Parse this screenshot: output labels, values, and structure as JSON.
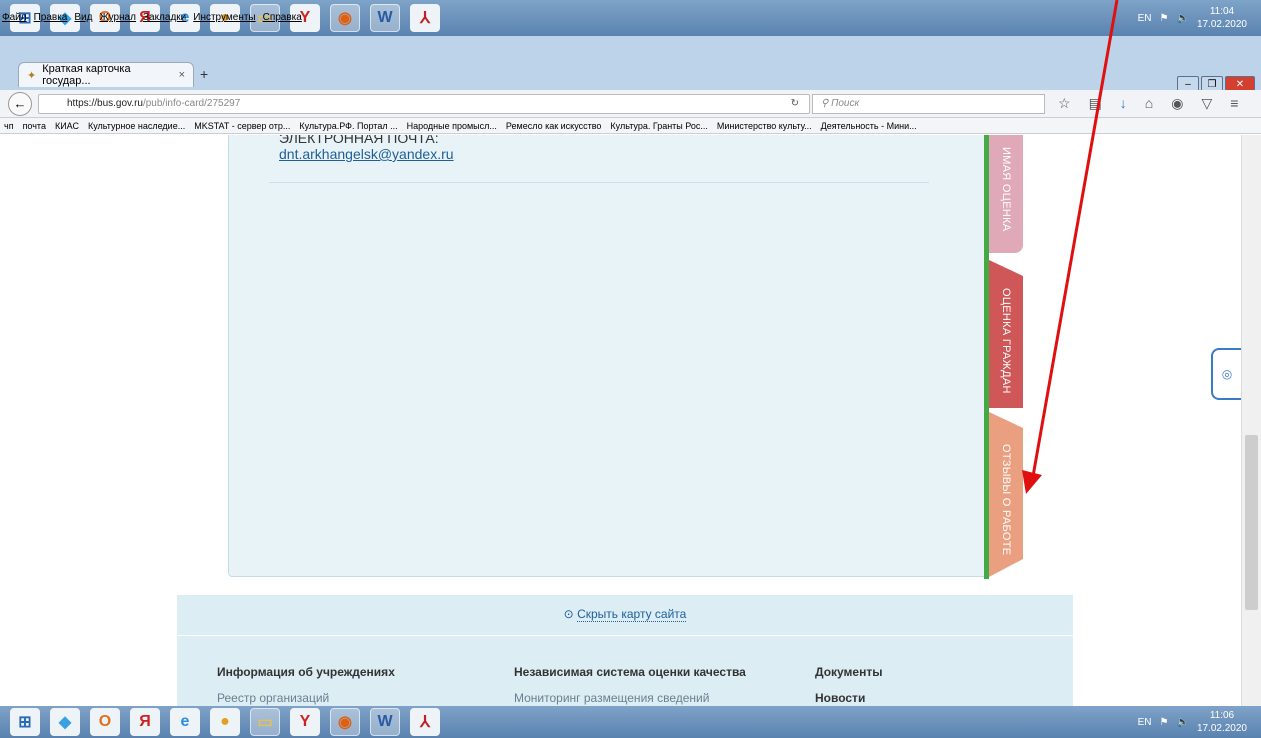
{
  "taskbar": {
    "apps": [
      {
        "name": "windows-start-icon",
        "glyph": "⊞",
        "color": "#2a6bb5"
      },
      {
        "name": "app-2-icon",
        "glyph": "◆",
        "color": "#3aa0e0"
      },
      {
        "name": "outlook-icon",
        "glyph": "O",
        "color": "#e07020"
      },
      {
        "name": "yandex-icon",
        "glyph": "Я",
        "color": "#d02020"
      },
      {
        "name": "ie-icon",
        "glyph": "e",
        "color": "#2a8fe0"
      },
      {
        "name": "chrome-icon",
        "glyph": "●",
        "color": "#e0a020"
      },
      {
        "name": "folder-icon",
        "glyph": "▭",
        "color": "#e8c050"
      },
      {
        "name": "yandex-browser-icon",
        "glyph": "Y",
        "color": "#d02020"
      },
      {
        "name": "firefox-icon",
        "glyph": "◉",
        "color": "#e06010"
      },
      {
        "name": "word-icon",
        "glyph": "W",
        "color": "#2a5aa0"
      },
      {
        "name": "acrobat-icon",
        "glyph": "⅄",
        "color": "#c02020"
      }
    ],
    "top_time": "11:04",
    "top_date": "17.02.2020",
    "bottom_time": "11:06",
    "bottom_date": "17.02.2020",
    "lang": "EN"
  },
  "menu": [
    "Файл",
    "Правка",
    "Вид",
    "Журнал",
    "Закладки",
    "Инструменты",
    "Справка"
  ],
  "tab": {
    "title": "Краткая карточка государ...",
    "close": "×",
    "new": "+"
  },
  "nav": {
    "url_host": "https://bus.gov.ru",
    "url_path": "/pub/info-card/275297",
    "search_placeholder": "Поиск"
  },
  "bookmarks": [
    "чп",
    "почта",
    "КИАС",
    "Культурное наследие...",
    "MKSTAT - сервер отр...",
    "Культура.РФ. Портал ...",
    "Народные промысл...",
    "Ремесло как искусство",
    "Культура. Гранты Рос...",
    "Министерство культу...",
    "Деятельность - Мини..."
  ],
  "card": {
    "email_label": "ЭЛЕКТРОННАЯ ПОЧТА:",
    "email": "dnt.arkhangelsk@yandex.ru"
  },
  "side_tabs": {
    "tab1": "ИМАЯ ОЦЕНКА",
    "tab2": "ОЦЕНКА ГРАЖДАН",
    "tab3": "ОТЗЫВЫ О РАБОТЕ"
  },
  "sitemap": {
    "hide_label": "Скрыть карту сайта",
    "col1_header": "Информация об учреждениях",
    "col1_item": "Реестр организаций",
    "col2_header": "Независимая система оценки качества",
    "col2_item": "Мониторинг размещения сведений",
    "col3_header": "Документы",
    "col3_item": "Новости"
  },
  "colors": {
    "arrow": "#e01010",
    "rating_tab": "#cf5757",
    "reviews_tab": "#eaa080",
    "green_bar": "#44aa44"
  }
}
